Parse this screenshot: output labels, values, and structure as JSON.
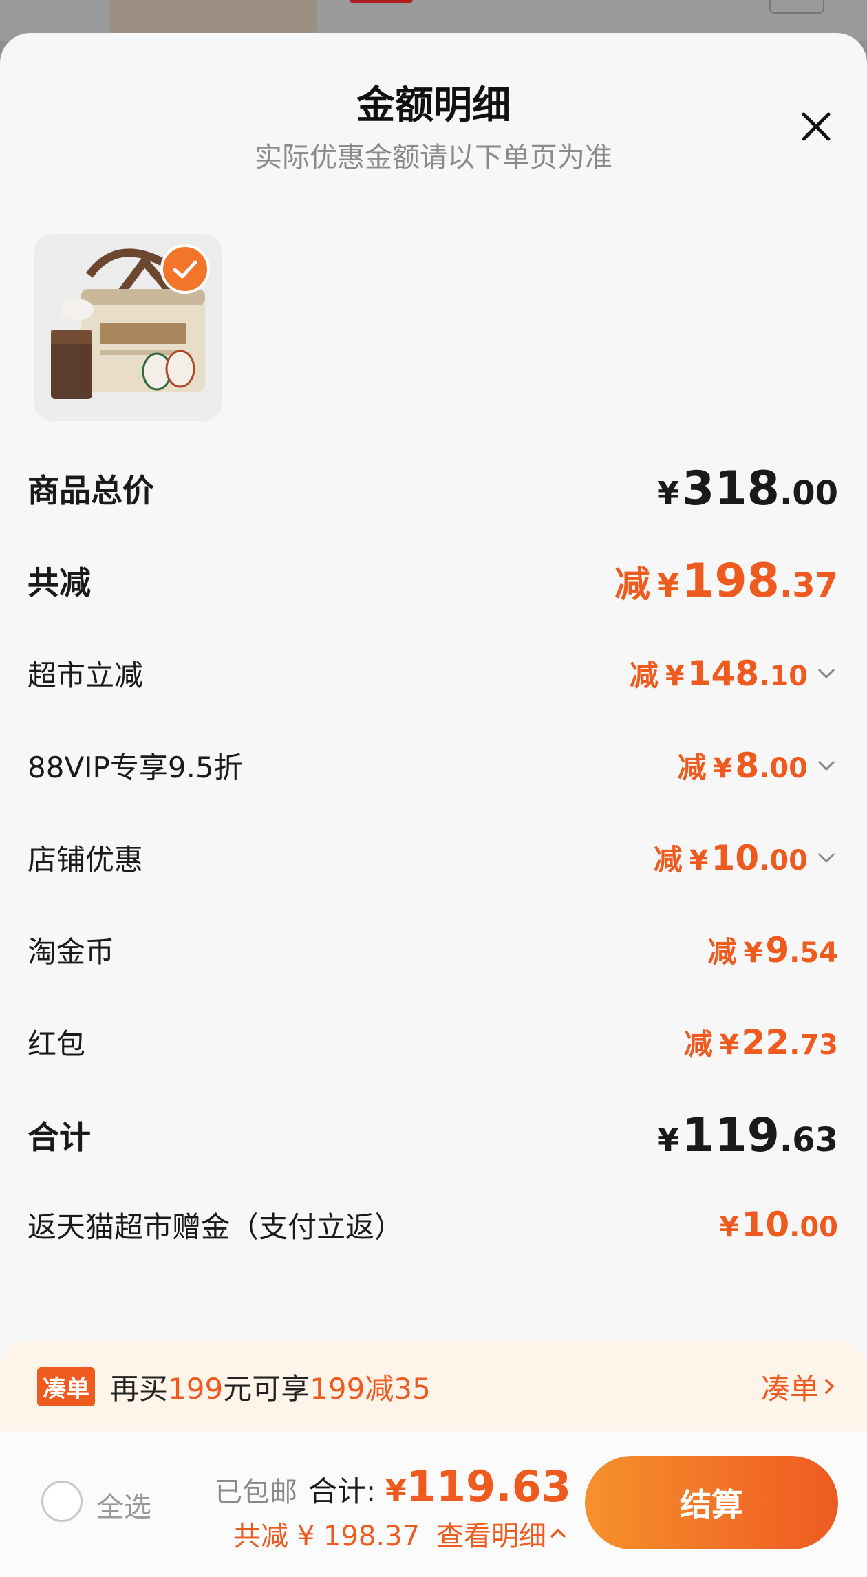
{
  "header": {
    "title": "金额明细",
    "subtitle": "实际优惠金额请以下单页为准"
  },
  "product": {
    "image_icon": "product-image",
    "selected": true
  },
  "rows": [
    {
      "label": "商品总价",
      "prefix": "",
      "symbol": "¥",
      "int": "318",
      "dec": ".00"
    },
    {
      "label": "共减",
      "prefix": "减",
      "symbol": "¥",
      "int": "198",
      "dec": ".37"
    },
    {
      "label": "超市立减",
      "prefix": "减",
      "symbol": "¥",
      "int": "148",
      "dec": ".10"
    },
    {
      "label": "88VIP专享9.5折",
      "prefix": "减",
      "symbol": "¥",
      "int": "8",
      "dec": ".00"
    },
    {
      "label": "店铺优惠",
      "prefix": "减",
      "symbol": "¥",
      "int": "10",
      "dec": ".00"
    },
    {
      "label": "淘金币",
      "prefix": "减",
      "symbol": "¥",
      "int": "9",
      "dec": ".54"
    },
    {
      "label": "红包",
      "prefix": "减",
      "symbol": "¥",
      "int": "22",
      "dec": ".73"
    },
    {
      "label": "合计",
      "prefix": "",
      "symbol": "¥",
      "int": "119",
      "dec": ".63"
    },
    {
      "label": "返天猫超市赠金（支付立返）",
      "prefix": "",
      "symbol": "¥",
      "int": "10",
      "dec": ".00"
    }
  ],
  "promo": {
    "tag": "凑单",
    "t1": "再买",
    "t2": "199",
    "t3": "元可享",
    "t4": "199减35",
    "link": "凑单"
  },
  "footer": {
    "select_all": "全选",
    "shipping": "已包邮",
    "total_label": "合计:",
    "total_symbol": "¥",
    "total_value": "119.63",
    "discount": "共减 ¥ 198.37",
    "detail_link": "查看明细",
    "checkout": "结算"
  },
  "colors": {
    "accent": "#ef5a1e",
    "button_start": "#f6912c",
    "button_end": "#ee5a22"
  }
}
